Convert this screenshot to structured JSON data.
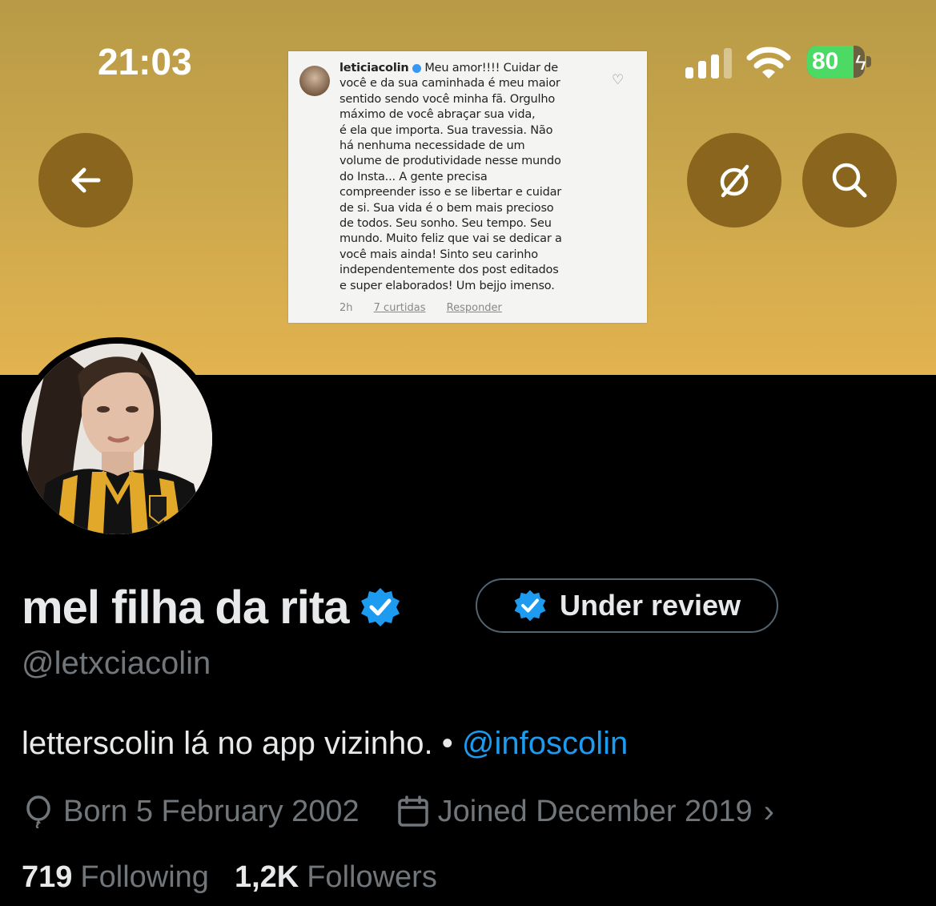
{
  "status_bar": {
    "time": "21:03",
    "battery": "80",
    "battery_level": 0.8
  },
  "header": {
    "back_icon": "arrow-left-icon",
    "grok_icon": "grok-icon",
    "search_icon": "search-icon"
  },
  "banner_image": {
    "username": "leticiacolin",
    "comment_lines": [
      "Meu amor!!!! Cuidar de",
      "você e da sua caminhada é meu maior",
      "sentido sendo você minha fã. Orgulho",
      "máximo de você abraçar sua vida,",
      " é ela que importa. Sua travessia. Não",
      "há nenhuma necessidade de um",
      "volume de produtividade nesse mundo",
      "do Insta... A gente precisa",
      "compreender isso e se libertar e cuidar",
      "de si. Sua vida é o bem mais precioso",
      "de todos. Seu sonho. Seu tempo. Seu",
      "mundo. Muito feliz que vai se dedicar a",
      "você mais ainda! Sinto seu carinho",
      "independentemente dos post editados",
      "e super elaborados! Um bejjo imenso."
    ],
    "time_ago": "2h",
    "likes": "7 curtidas",
    "reply": "Responder"
  },
  "profile": {
    "display_name": "mel filha da rita",
    "review_label": "Under review",
    "handle": "@letxciacolin",
    "bio_text": "letterscolin lá no app vizinho. • ",
    "bio_link": "@infoscolin",
    "born": "Born 5 February 2002",
    "joined": "Joined December 2019",
    "following_count": "719",
    "following_label": "Following",
    "followers_count": "1,2K",
    "followers_label": "Followers"
  },
  "colors": {
    "verified": "#1d9bf0",
    "link": "#1d9bf0",
    "button_bg": "#8a651d"
  }
}
